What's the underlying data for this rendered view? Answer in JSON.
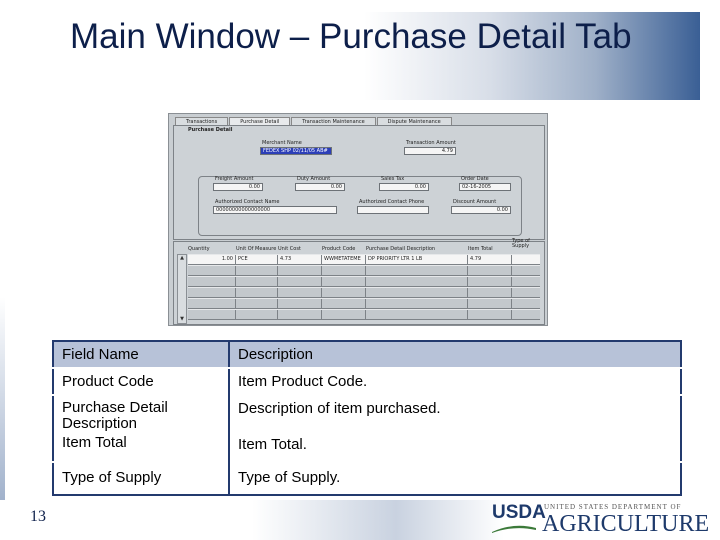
{
  "slide": {
    "title": "Main Window – Purchase Detail Tab",
    "number": "13"
  },
  "screenshot": {
    "tabs": [
      "Transactions",
      "Purchase Detail",
      "Transaction Maintenance",
      "Dispute Maintenance"
    ],
    "active_tab": "Purchase Detail",
    "panel_title": "Purchase Detail",
    "fields": {
      "merchant_name": {
        "label": "Merchant Name",
        "value": "FEDEX SHP 02/11/05 AB#"
      },
      "transaction_amount": {
        "label": "Transaction Amount",
        "value": "4.79"
      },
      "freight_amount": {
        "label": "Freight Amount",
        "value": "0.00"
      },
      "duty_amount": {
        "label": "Duty Amount",
        "value": "0.00"
      },
      "sales_tax": {
        "label": "Sales Tax",
        "value": "0.00"
      },
      "order_date": {
        "label": "Order Date",
        "value": "02-16-2005"
      },
      "authorized_contact_name": {
        "label": "Authorized Contact Name",
        "value": "00000000000000000"
      },
      "authorized_contact_phone": {
        "label": "Authorized Contact Phone",
        "value": ""
      },
      "discount_amount": {
        "label": "Discount Amount",
        "value": "0.00"
      }
    },
    "grid": {
      "headers": [
        "Quantity",
        "Unit Of Measure",
        "Unit Cost",
        "Product Code",
        "Purchase Detail Description",
        "Item Total",
        "Type of Supply"
      ],
      "rows": [
        [
          "1.00",
          "PCE",
          "4.73",
          "WWMETATEME",
          "DP PRIORITY LTR 1 LB",
          "4.79",
          ""
        ]
      ]
    }
  },
  "table": {
    "header": {
      "field": "Field Name",
      "description": "Description"
    },
    "rows": [
      {
        "field": "Product Code",
        "description": "Item Product Code."
      },
      {
        "field": "Purchase Detail Description",
        "description": "Description of item purchased."
      },
      {
        "field": "Item Total",
        "description": "Item Total."
      },
      {
        "field": "Type of Supply",
        "description": "Type of Supply."
      }
    ]
  },
  "logo": {
    "mark": "USDA",
    "top_line": "UNITED STATES DEPARTMENT OF",
    "main": "AGRICULTURE"
  },
  "colors": {
    "title": "#0d1f4a",
    "table_border": "#233a6e",
    "table_header_bg": "#b7c2d8",
    "highlight_field": "#2c3fb8"
  }
}
